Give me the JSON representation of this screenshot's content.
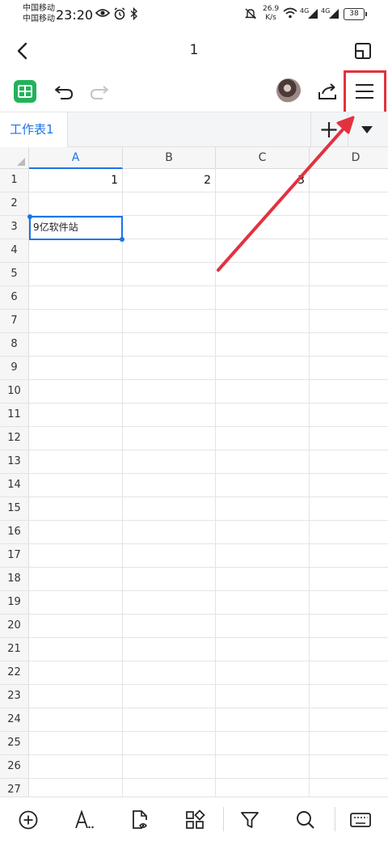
{
  "status_bar": {
    "carrier_1": "中国移动",
    "carrier_2": "中国移动",
    "time": "23:20",
    "net_speed_value": "26.9",
    "net_speed_unit": "K/s",
    "signal_1_label": "4G",
    "signal_2_label": "4G",
    "battery": "38"
  },
  "title_bar": {
    "title": "1"
  },
  "sheet_tabs": {
    "active_tab": "工作表1"
  },
  "grid": {
    "columns": [
      "A",
      "B",
      "C",
      "D"
    ],
    "rows": [
      "1",
      "2",
      "3",
      "4",
      "5",
      "6",
      "7",
      "8",
      "9",
      "10",
      "11",
      "12",
      "13",
      "14",
      "15",
      "16",
      "17",
      "18",
      "19",
      "20",
      "21",
      "22",
      "23",
      "24",
      "25",
      "26",
      "27"
    ],
    "cells": {
      "A1": "1",
      "B1": "2",
      "C1": "3",
      "A3": "9亿软件站"
    }
  },
  "colors": {
    "accent": "#1a73e8",
    "sheet_logo": "#21b35a",
    "annotation": "#e2323f"
  },
  "icons": {
    "back": "chevron-left-icon",
    "window": "window-icon",
    "undo": "undo-icon",
    "redo": "redo-icon",
    "share": "share-icon",
    "menu": "hamburger-menu-icon",
    "add_sheet": "plus-icon",
    "sheet_menu": "caret-down-icon",
    "bottom": [
      "plus-circle-icon",
      "text-format-icon",
      "file-view-icon",
      "apps-icon",
      "filter-icon",
      "search-icon",
      "keyboard-icon"
    ]
  }
}
